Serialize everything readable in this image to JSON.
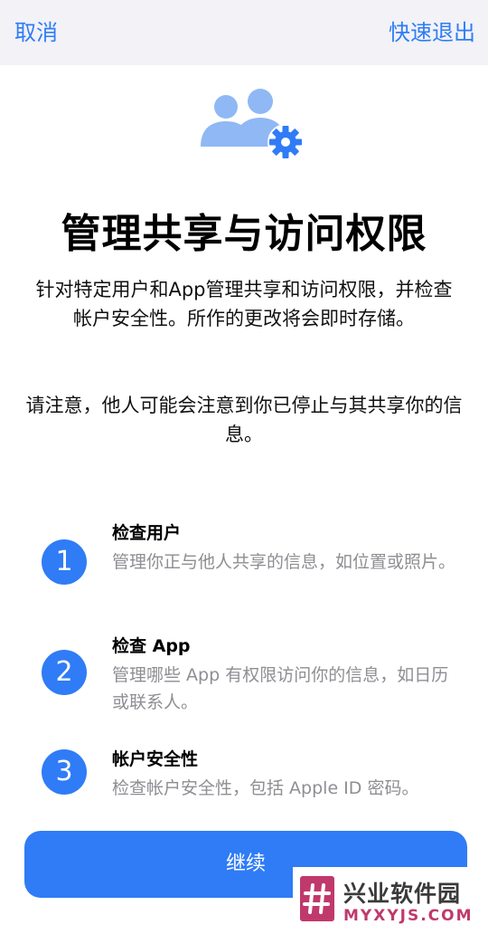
{
  "nav": {
    "cancel_label": "取消",
    "quick_exit_label": "快速退出"
  },
  "hero": {
    "icon": "people-gear-icon",
    "accent_color": "#2f7cf6",
    "light_color": "#8fb8f5"
  },
  "title": "管理共享与访问权限",
  "description": "针对特定用户和App管理共享和访问权限，并检查帐户安全性。所作的更改将会即时存储。",
  "note": "请注意，他人可能会注意到你已停止与其共享你的信息。",
  "steps": [
    {
      "number": "1",
      "title": "检查用户",
      "desc": "管理你正与他人共享的信息，如位置或照片。"
    },
    {
      "number": "2",
      "title": "检查 App",
      "desc": "管理哪些 App 有权限访问你的信息，如日历或联系人。"
    },
    {
      "number": "3",
      "title": "帐户安全性",
      "desc": "检查帐户安全性，包括 Apple ID 密码。"
    }
  ],
  "continue_label": "继续",
  "watermark": {
    "name_cn": "兴业软件园",
    "name_en": "MYXYJS.COM"
  }
}
